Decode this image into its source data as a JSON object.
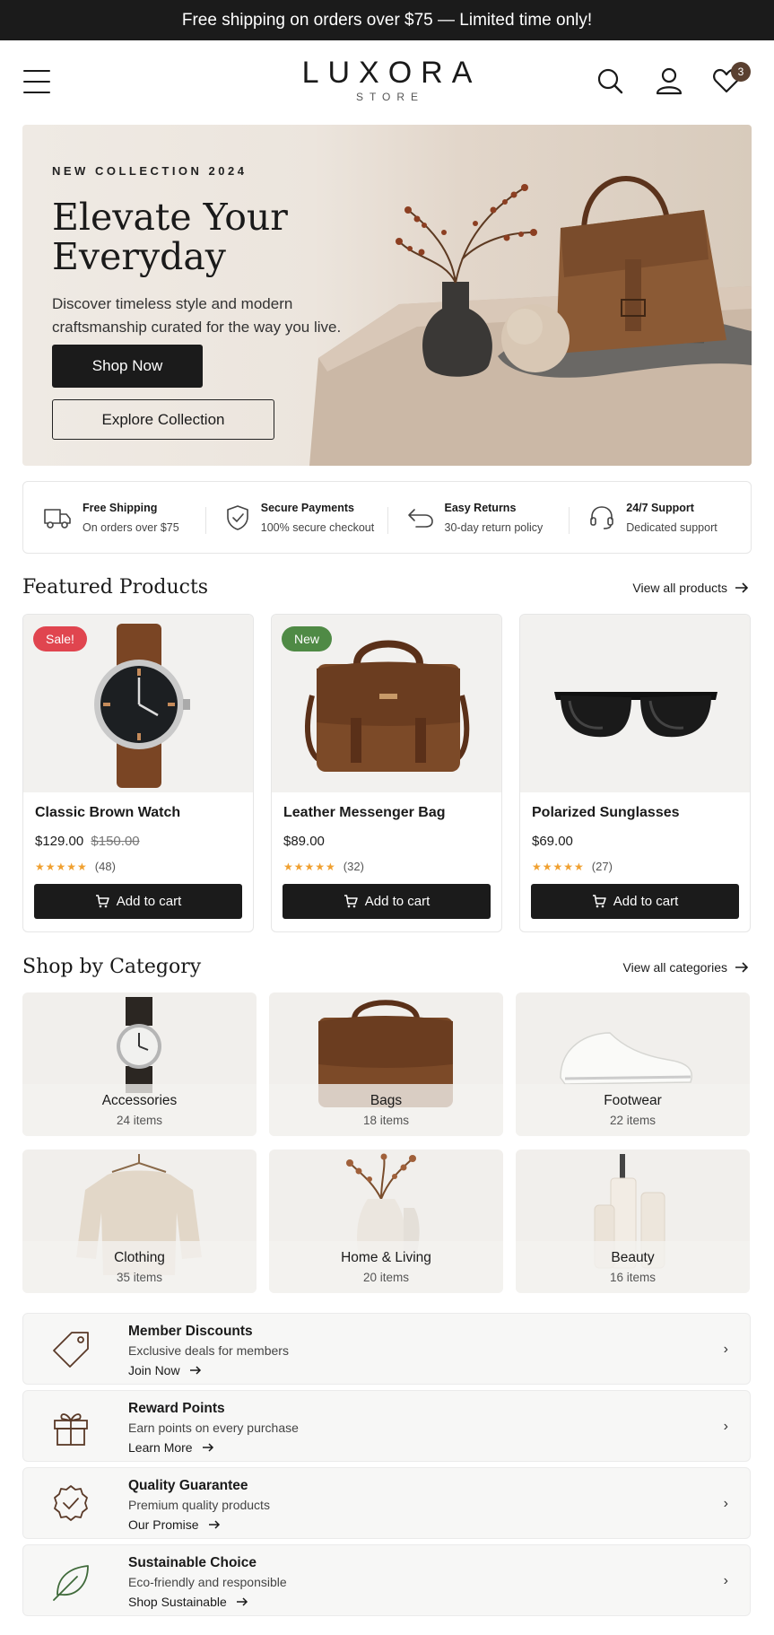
{
  "promo_bar": {
    "text": "Free shipping on orders over $75 — Limited time only!"
  },
  "header": {
    "logo_name": "LUXORA",
    "logo_sub": "STORE",
    "wishlist_count": "3"
  },
  "hero": {
    "eyebrow": "NEW COLLECTION 2024",
    "title_line1": "Elevate Your",
    "title_line2": "Everyday",
    "description": "Discover timeless style and modern craftsmanship curated for the way you live.",
    "primary_button": "Shop Now",
    "secondary_button": "Explore Collection"
  },
  "features": [
    {
      "title": "Free Shipping",
      "subtitle": "On orders over $75",
      "icon": "truck-icon"
    },
    {
      "title": "Secure Payments",
      "subtitle": "100% secure checkout",
      "icon": "shield-check-icon"
    },
    {
      "title": "Easy Returns",
      "subtitle": "30-day return policy",
      "icon": "return-arrow-icon"
    },
    {
      "title": "24/7 Support",
      "subtitle": "Dedicated support",
      "icon": "headset-icon"
    }
  ],
  "featured": {
    "title": "Featured Products",
    "view_all": "View all products",
    "products": [
      {
        "name": "Classic Brown Watch",
        "price": "$129.00",
        "old_price": "$150.00",
        "tag": "Sale!",
        "tag_color": "#e0454f",
        "rating": "(48)",
        "stars": "★★★★★",
        "cta": "Add to cart"
      },
      {
        "name": "Leather Messenger Bag",
        "price": "$89.00",
        "old_price": "",
        "tag": "New",
        "tag_color": "#4f8a45",
        "rating": "(32)",
        "stars": "★★★★★",
        "cta": "Add to cart"
      },
      {
        "name": "Polarized Sunglasses",
        "price": "$69.00",
        "old_price": "",
        "tag": "",
        "tag_color": "",
        "rating": "(27)",
        "stars": "★★★★★",
        "cta": "Add to cart"
      }
    ]
  },
  "categories": {
    "title": "Shop by Category",
    "view_all": "View all categories",
    "items": [
      {
        "name": "Accessories",
        "count": "24 items"
      },
      {
        "name": "Bags",
        "count": "18 items"
      },
      {
        "name": "Footwear",
        "count": "22 items"
      },
      {
        "name": "Clothing",
        "count": "35 items"
      },
      {
        "name": "Home & Living",
        "count": "20 items"
      },
      {
        "name": "Beauty",
        "count": "16 items"
      }
    ]
  },
  "benefits": [
    {
      "title": "Member Discounts",
      "subtitle": "Exclusive deals for members",
      "link": "Join Now",
      "icon": "tag-icon"
    },
    {
      "title": "Reward Points",
      "subtitle": "Earn points on every purchase",
      "link": "Learn More",
      "icon": "gift-icon"
    },
    {
      "title": "Quality Guarantee",
      "subtitle": "Premium quality products",
      "link": "Our Promise",
      "icon": "badge-check-icon"
    },
    {
      "title": "Sustainable Choice",
      "subtitle": "Eco-friendly and responsible",
      "link": "Shop Sustainable",
      "icon": "leaf-icon"
    }
  ],
  "colors": {
    "dark": "#1b1b1b",
    "sale": "#e0454f",
    "new": "#4f8a45",
    "star": "#f0a030",
    "accent_brown": "#8a5a34"
  }
}
